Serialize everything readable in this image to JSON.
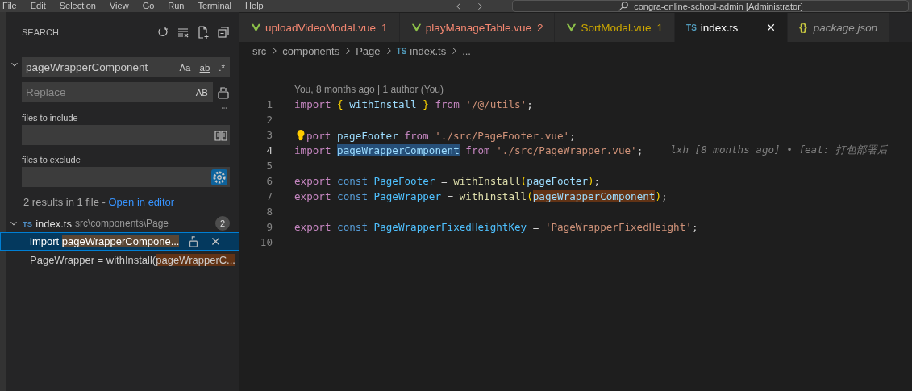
{
  "menu": [
    "File",
    "Edit",
    "Selection",
    "View",
    "Go",
    "Run",
    "Terminal",
    "Help"
  ],
  "command_center": {
    "title": "congra-online-school-admin [Administrator]"
  },
  "sidebar": {
    "title": "SEARCH",
    "search": {
      "value": "pageWrapperComponent",
      "replace_expanded": true,
      "options": [
        {
          "label": "Aa",
          "on": false
        },
        {
          "label": "ab",
          "on": false
        },
        {
          "label": ".*",
          "on": false
        }
      ]
    },
    "replace": {
      "placeholder": "Replace",
      "preserve_case": {
        "label": "AB",
        "on": false
      }
    },
    "include": {
      "label": "files to include"
    },
    "exclude": {
      "label": "files to exclude",
      "use_exclude_settings": true
    },
    "summary": {
      "text": "2 results in 1 file - ",
      "link": "Open in editor"
    },
    "files": [
      {
        "icon": "TS",
        "name": "index.ts",
        "path": "src\\components\\Page",
        "count": "2",
        "expanded": true,
        "matches": [
          {
            "before": "import ",
            "match": "pageWrapperCompone...",
            "selected": true
          },
          {
            "before": "PageWrapper = withInstall(",
            "match": "pageWrapperC...",
            "selected": false
          }
        ]
      }
    ]
  },
  "tabs": [
    {
      "kind": "vue",
      "label": "uploadVideoModal.vue",
      "badge": "1",
      "color": "#f48771",
      "selected": false,
      "preview": false
    },
    {
      "kind": "vue",
      "label": "playManageTable.vue",
      "badge": "2",
      "color": "#f48771",
      "selected": false,
      "preview": false
    },
    {
      "kind": "vue",
      "label": "SortModal.vue",
      "badge": "1",
      "color": "#cca700",
      "selected": false,
      "preview": false
    },
    {
      "kind": "ts",
      "icon": "TS",
      "label": "index.ts",
      "color": "#ffffff",
      "selected": true,
      "preview": false
    },
    {
      "kind": "json",
      "icon": "{}",
      "label": "package.json",
      "color": "#9d9d9d",
      "selected": false,
      "preview": true
    }
  ],
  "breadcrumb": [
    {
      "label": "src"
    },
    {
      "label": "components"
    },
    {
      "label": "Page"
    },
    {
      "icon": "TS",
      "label": "index.ts"
    },
    {
      "label": "..."
    }
  ],
  "editor": {
    "codelens": "You, 8 months ago | 1 author (You)",
    "lines": [
      {
        "number": "1",
        "current": false,
        "tokens": [
          {
            "text": "import ",
            "kind": "keyword"
          },
          {
            "text": "{ ",
            "kind": "bracket"
          },
          {
            "text": "withInstall ",
            "kind": "variable"
          },
          {
            "text": "} ",
            "kind": "bracket"
          },
          {
            "text": "from ",
            "kind": "keyword"
          },
          {
            "text": "'/@/utils'",
            "kind": "string"
          },
          {
            "text": ";",
            "kind": "plain"
          }
        ]
      },
      {
        "number": "2",
        "current": false
      },
      {
        "number": "3",
        "current": false,
        "tokens": [
          {
            "kind": "bulb"
          },
          {
            "text": "port ",
            "kind": "keyword"
          },
          {
            "text": "pageFooter ",
            "kind": "variable"
          },
          {
            "text": "from ",
            "kind": "keyword"
          },
          {
            "text": "'./src/PageFooter.vue'",
            "kind": "string"
          },
          {
            "text": ";",
            "kind": "plain"
          }
        ]
      },
      {
        "number": "4",
        "current": true,
        "tokens": [
          {
            "text": "import ",
            "kind": "keyword"
          },
          {
            "text": "pageWrapperComponent",
            "kind": "variable",
            "selection": true
          },
          {
            "text": " from ",
            "kind": "keyword"
          },
          {
            "text": "'./src/PageWrapper.vue'",
            "kind": "string"
          },
          {
            "text": ";",
            "kind": "plain"
          }
        ],
        "blame": "lxh [8 months ago] • feat: 打包部署后"
      },
      {
        "number": "5",
        "current": false
      },
      {
        "number": "6",
        "current": false,
        "tokens": [
          {
            "text": "export ",
            "kind": "keyword"
          },
          {
            "text": "const ",
            "kind": "storage"
          },
          {
            "text": "PageFooter",
            "kind": "constant"
          },
          {
            "text": " = ",
            "kind": "plain"
          },
          {
            "text": "withInstall",
            "kind": "function"
          },
          {
            "text": "(",
            "kind": "bracket"
          },
          {
            "text": "pageFooter",
            "kind": "variable"
          },
          {
            "text": ")",
            "kind": "bracket"
          },
          {
            "text": ";",
            "kind": "plain"
          }
        ]
      },
      {
        "number": "7",
        "current": false,
        "tokens": [
          {
            "text": "export ",
            "kind": "keyword"
          },
          {
            "text": "const ",
            "kind": "storage"
          },
          {
            "text": "PageWrapper",
            "kind": "constant"
          },
          {
            "text": " = ",
            "kind": "plain"
          },
          {
            "text": "withInstall",
            "kind": "function"
          },
          {
            "text": "(",
            "kind": "bracket"
          },
          {
            "text": "pageWrapperComponent",
            "kind": "variable",
            "search_match": true
          },
          {
            "text": ")",
            "kind": "bracket"
          },
          {
            "text": ";",
            "kind": "plain"
          }
        ]
      },
      {
        "number": "8",
        "current": false
      },
      {
        "number": "9",
        "current": false,
        "tokens": [
          {
            "text": "export ",
            "kind": "keyword"
          },
          {
            "text": "const ",
            "kind": "storage"
          },
          {
            "text": "PageWrapperFixedHeightKey",
            "kind": "constant"
          },
          {
            "text": " = ",
            "kind": "plain"
          },
          {
            "text": "'PageWrapperFixedHeight'",
            "kind": "string"
          },
          {
            "text": ";",
            "kind": "plain"
          }
        ]
      },
      {
        "number": "10",
        "current": false
      }
    ]
  }
}
